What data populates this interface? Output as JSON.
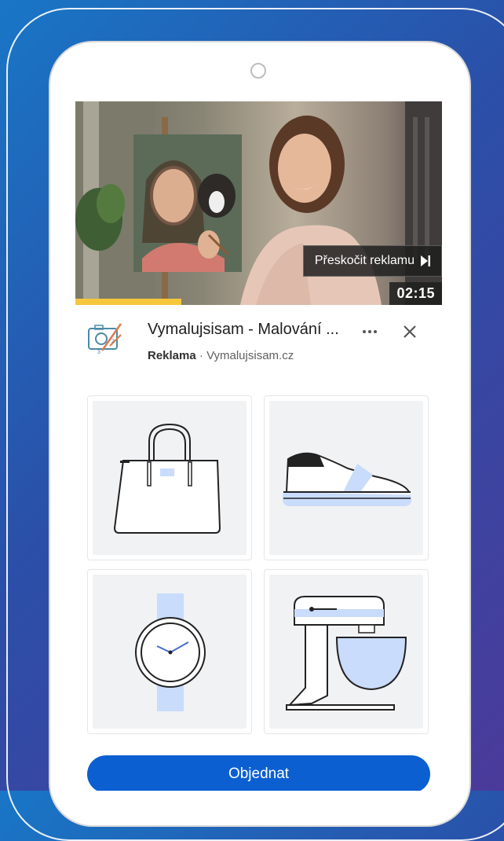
{
  "video": {
    "skip_label": "Přeskočit reklamu",
    "skip_icon": "skip-next-icon",
    "duration": "02:15",
    "progress_fraction": 0.29
  },
  "ad": {
    "title": "Vymalujsisam - Malování ...",
    "label": "Reklama",
    "separator": " · ",
    "domain": "Vymalujsisam.cz"
  },
  "products": [
    {
      "icon": "handbag-icon"
    },
    {
      "icon": "sneaker-icon"
    },
    {
      "icon": "wristwatch-icon"
    },
    {
      "icon": "stand-mixer-icon"
    }
  ],
  "cta": {
    "label": "Objednat"
  },
  "colors": {
    "accent": "#0b5fd1",
    "progress": "#f6c63c",
    "product_highlight": "#c9dcfb"
  }
}
